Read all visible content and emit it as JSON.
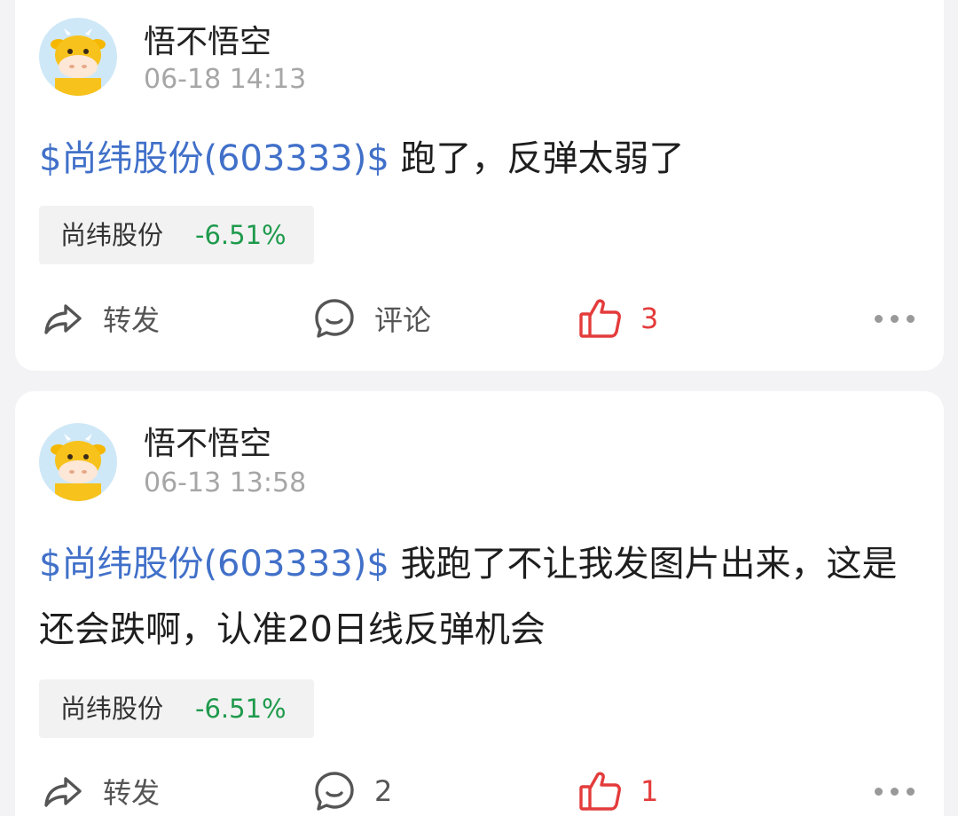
{
  "posts": [
    {
      "username": "悟不悟空",
      "timestamp": "06-18 14:13",
      "stock_link": "$尚纬股份(603333)$",
      "text": " 跑了，反弹太弱了",
      "stock_tag": {
        "name": "尚纬股份",
        "change": "-6.51%"
      },
      "actions": {
        "repost_label": "转发",
        "comment_label": "评论",
        "like_count": "3"
      }
    },
    {
      "username": "悟不悟空",
      "timestamp": "06-13 13:58",
      "stock_link": "$尚纬股份(603333)$",
      "text": " 我跑了不让我发图片出来，这是还会跌啊，认准20日线反弹机会",
      "stock_tag": {
        "name": "尚纬股份",
        "change": "-6.51%"
      },
      "actions": {
        "repost_label": "转发",
        "comment_count": "2",
        "like_count": "1"
      }
    }
  ],
  "icons": {
    "avatar": "cow-avatar-icon",
    "repost": "share-arrow-icon",
    "comment": "comment-bubble-icon",
    "like": "thumbs-up-icon",
    "more": "more-dots-icon"
  },
  "colors": {
    "stock_link": "#4170c9",
    "negative_change": "#1e9a4c",
    "like_active": "#e43b3b",
    "timestamp": "#a6a6a6",
    "tag_background": "#f2f2f2",
    "avatar_background": "#cfe8f7"
  }
}
